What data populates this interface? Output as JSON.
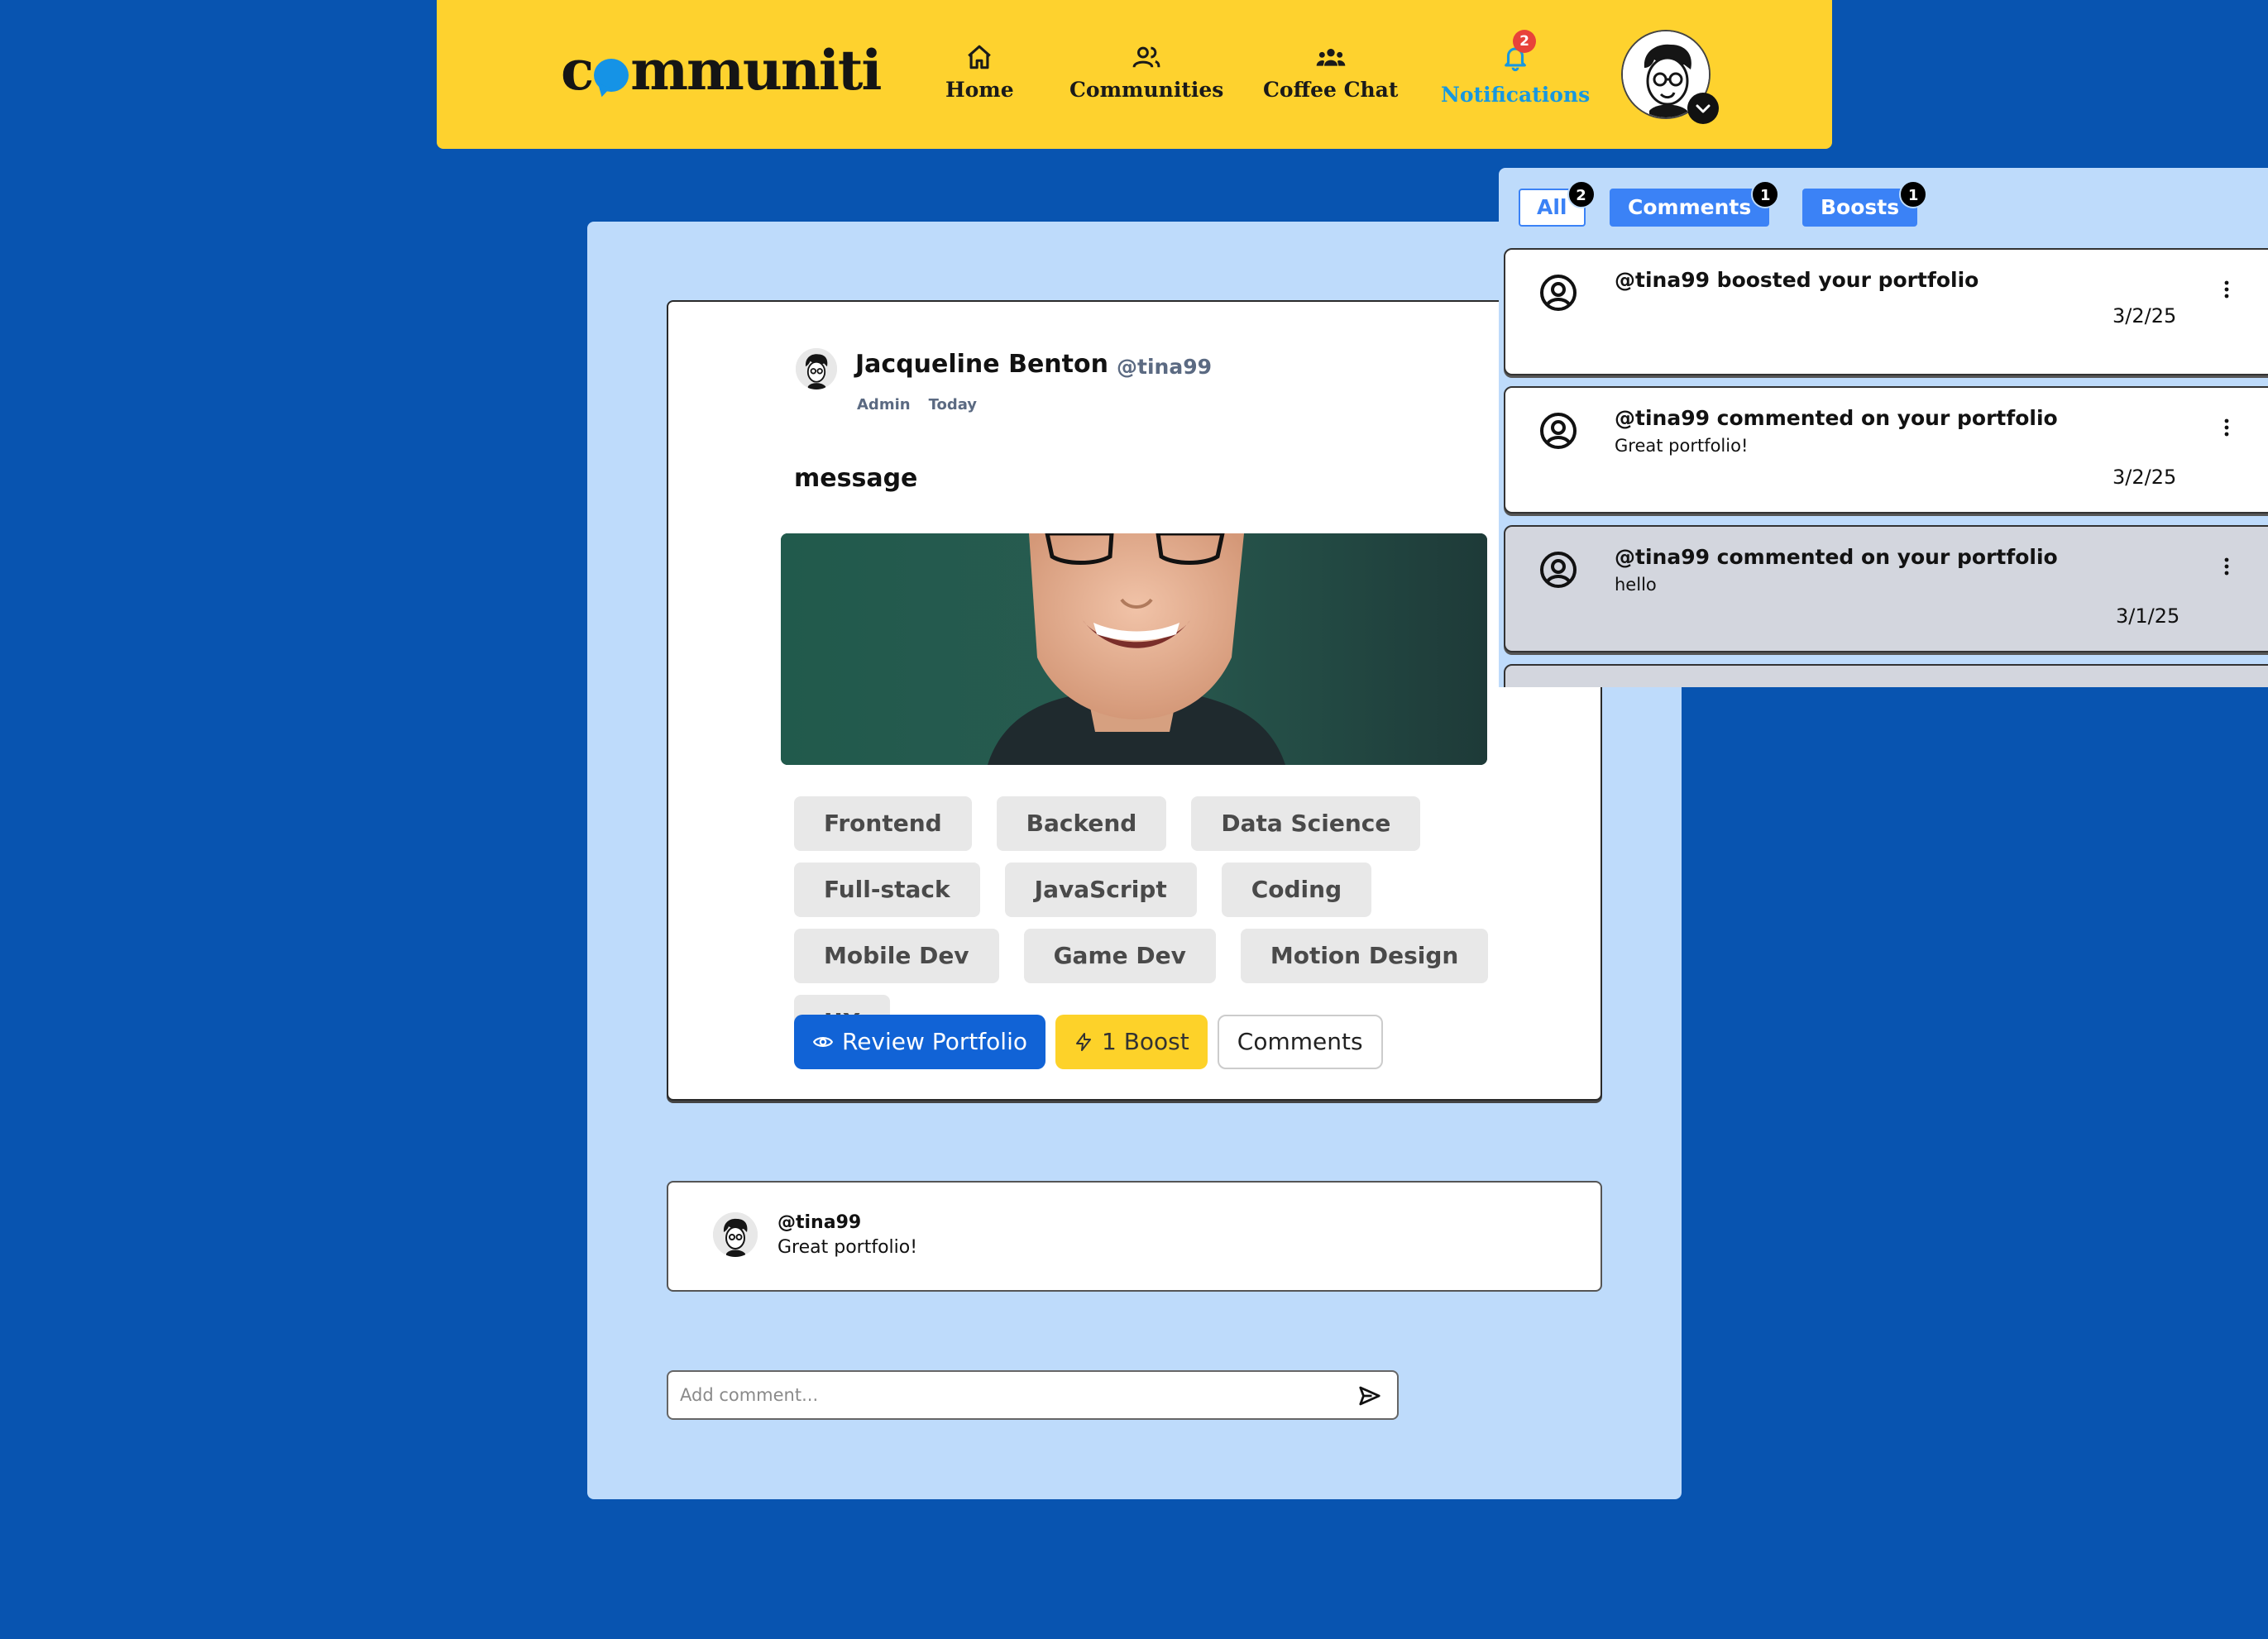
{
  "nav": {
    "logo_left": "c",
    "logo_right": "mmuniti",
    "items": [
      {
        "label": "Home",
        "icon": "home-icon"
      },
      {
        "label": "Communities",
        "icon": "communities-icon"
      },
      {
        "label": "Coffee Chat",
        "icon": "coffee-chat-icon"
      },
      {
        "label": "Notifications",
        "icon": "bell-icon",
        "badge": "2"
      }
    ],
    "active_color": "#1798e0",
    "background": "#fed22e"
  },
  "post": {
    "author_name": "Jacqueline Benton",
    "author_handle": "@tina99",
    "role": "Admin",
    "time": "Today",
    "title": "message",
    "tags": [
      "Frontend",
      "Backend",
      "Data Science",
      "Full-stack",
      "JavaScript",
      "Coding",
      "Mobile Dev",
      "Game Dev",
      "Motion Design",
      "UX"
    ],
    "review_label": "Review Portfolio",
    "boost_label": "1 Boost",
    "comments_label": "Comments"
  },
  "comment": {
    "user": "@tina99",
    "text": "Great portfolio!"
  },
  "comment_input": {
    "placeholder": "Add comment..."
  },
  "notifications": {
    "tabs": [
      {
        "label": "All",
        "badge": "2"
      },
      {
        "label": "Comments",
        "badge": "1"
      },
      {
        "label": "Boosts",
        "badge": "1"
      }
    ],
    "items": [
      {
        "title": "@tina99 boosted your portfolio",
        "body": "",
        "date": "3/2/25",
        "read": false
      },
      {
        "title": "@tina99 commented on your portfolio",
        "body": "Great portfolio!",
        "date": "3/2/25",
        "read": false
      },
      {
        "title": "@tina99 commented on your portfolio",
        "body": "hello",
        "date": "3/1/25",
        "read": true
      }
    ]
  },
  "colors": {
    "page_bg": "#0854b0",
    "panel_bg": "#bedbfb",
    "primary": "#1163d6",
    "boost": "#fdd229",
    "tab_blue": "#3b82f6"
  }
}
